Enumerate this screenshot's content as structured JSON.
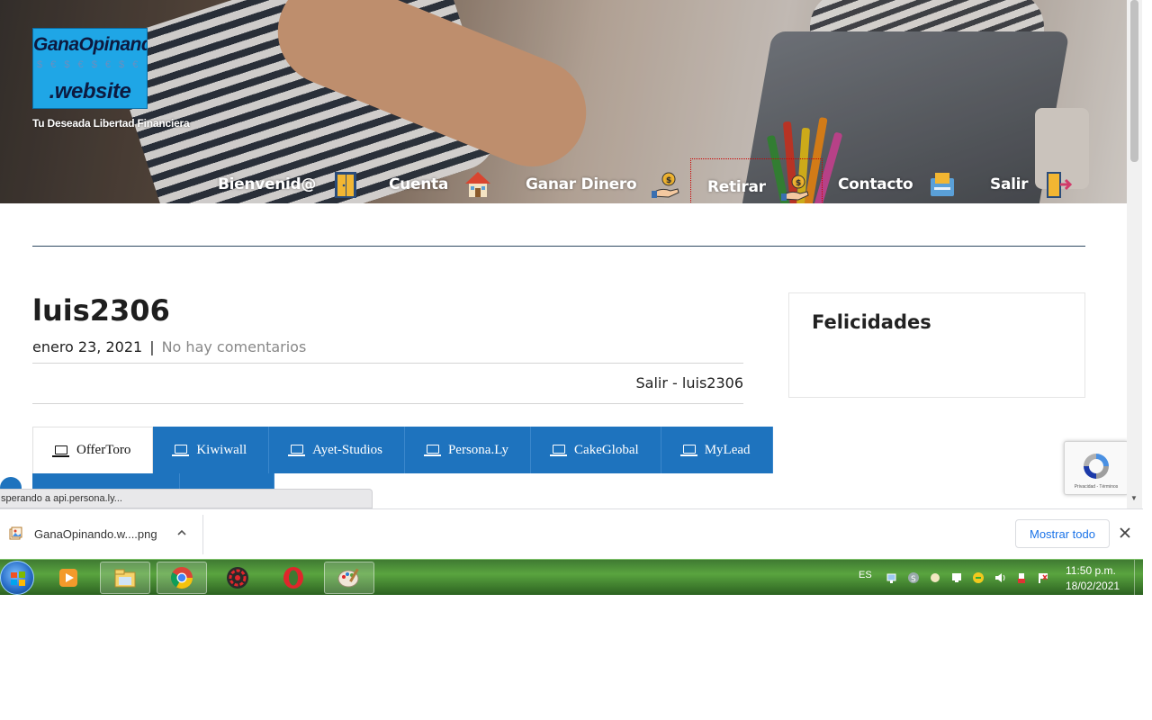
{
  "header": {
    "logo_line1": "GanaOpinando",
    "logo_line2": ".website",
    "tagline": "Tu Deseada Libertad Financiera",
    "nav": [
      {
        "label": "Bienvenid@",
        "icon": "door-icon"
      },
      {
        "label": "Cuenta",
        "icon": "house-icon"
      },
      {
        "label": "Ganar Dinero",
        "icon": "money-hand-icon"
      },
      {
        "label": "Retirar",
        "icon": "money-hand-icon"
      },
      {
        "label": "Contacto",
        "icon": "contact-icon"
      },
      {
        "label": "Salir",
        "icon": "exit-door-icon"
      }
    ]
  },
  "post": {
    "title": "luis2306",
    "date": "enero 23, 2021",
    "separator": "|",
    "comments": "No hay comentarios",
    "logout_prefix": "Salir",
    "logout_sep": " - ",
    "username": "luis2306"
  },
  "tabs": [
    {
      "label": "OfferToro",
      "active": true
    },
    {
      "label": "Kiwiwall",
      "active": false
    },
    {
      "label": "Ayet-Studios",
      "active": false
    },
    {
      "label": "Persona.Ly",
      "active": false
    },
    {
      "label": "CakeGlobal",
      "active": false
    },
    {
      "label": "MyLead",
      "active": false
    }
  ],
  "sidebar": {
    "title": "Felicidades"
  },
  "recaptcha": {
    "text": "Privacidad - Términos"
  },
  "status_bubble": "sperando a api.persona.ly...",
  "download_bar": {
    "file_name": "GanaOpinando.w....png",
    "show_all": "Mostrar todo"
  },
  "taskbar": {
    "lang": "ES",
    "time": "11:50 p.m.",
    "date": "18/02/2021",
    "apps": [
      "media-player-icon",
      "file-explorer-icon",
      "chrome-icon",
      "red-gear-app-icon",
      "opera-icon",
      "paint-icon"
    ]
  },
  "colors": {
    "tab_blue": "#1e73be",
    "divider": "#2f4a62",
    "taskbar_green": "#5aa43f",
    "link_blue": "#1a73e8"
  }
}
